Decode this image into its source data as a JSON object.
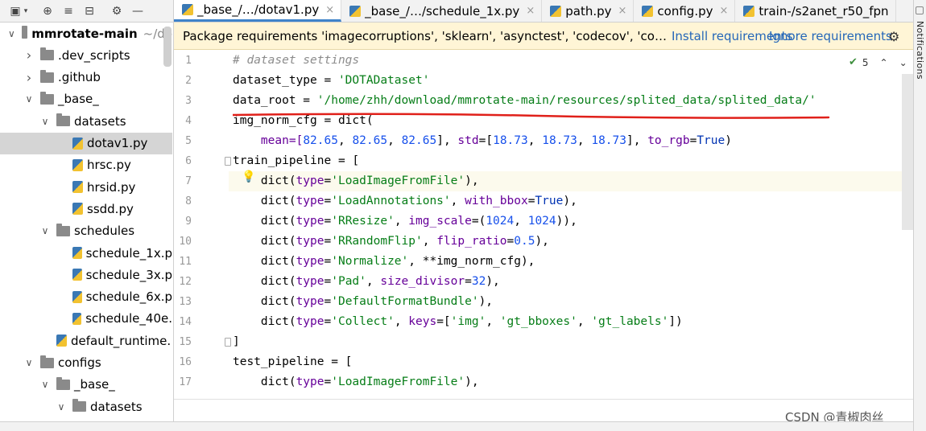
{
  "tabs": [
    {
      "label": "_base_/…/dotav1.py",
      "active": true,
      "closable": true,
      "icon": "python-file-icon"
    },
    {
      "label": "_base_/…/schedule_1x.py",
      "active": false,
      "closable": true,
      "icon": "python-file-icon"
    },
    {
      "label": "path.py",
      "active": false,
      "closable": true,
      "icon": "python-file-icon"
    },
    {
      "label": "config.py",
      "active": false,
      "closable": true,
      "icon": "python-file-icon"
    },
    {
      "label": "train-/s2anet_r50_fpn",
      "active": false,
      "closable": false,
      "icon": "python-file-icon"
    }
  ],
  "tab_close_glyph": "×",
  "project_tools": [
    "window-icon",
    "target-icon",
    "collapse-all-icon",
    "expand-all-icon",
    "gear-icon",
    "minimize-icon"
  ],
  "notifications_label": "Notifications",
  "tree": [
    {
      "label": "mmrotate-main",
      "suffix": "~/do",
      "kind": "root",
      "expanded": true,
      "bold": true
    },
    {
      "label": ".dev_scripts",
      "kind": "folder",
      "expanded": false
    },
    {
      "label": ".github",
      "kind": "folder",
      "expanded": false
    },
    {
      "label": "_base_",
      "kind": "folder",
      "expanded": true
    },
    {
      "label": "datasets",
      "kind": "folder",
      "expanded": true
    },
    {
      "label": "dotav1.py",
      "kind": "file",
      "selected": true
    },
    {
      "label": "hrsc.py",
      "kind": "file"
    },
    {
      "label": "hrsid.py",
      "kind": "file"
    },
    {
      "label": "ssdd.py",
      "kind": "file"
    },
    {
      "label": "schedules",
      "kind": "folder",
      "expanded": true
    },
    {
      "label": "schedule_1x.p",
      "kind": "file"
    },
    {
      "label": "schedule_3x.p",
      "kind": "file"
    },
    {
      "label": "schedule_6x.p",
      "kind": "file"
    },
    {
      "label": "schedule_40e.",
      "kind": "file"
    },
    {
      "label": "default_runtime.",
      "kind": "file"
    },
    {
      "label": "configs",
      "kind": "folder",
      "expanded": true
    },
    {
      "label": "_base_",
      "kind": "folder",
      "expanded": true
    },
    {
      "label": "datasets",
      "kind": "folder",
      "expanded": true
    }
  ],
  "banner": {
    "text": "Package requirements 'imagecorruptions', 'sklearn', 'asynctest', 'codecov', 'co…",
    "install_label": "Install requirements",
    "ignore_label": "Ignore requirements"
  },
  "inspections": {
    "count": "5"
  },
  "code_lines": [
    {
      "n": "1",
      "tokens": [
        {
          "t": "# dataset settings",
          "c": "com"
        }
      ]
    },
    {
      "n": "2",
      "tokens": [
        {
          "t": "dataset_type = ",
          "c": ""
        },
        {
          "t": "'DOTADataset'",
          "c": "str"
        }
      ]
    },
    {
      "n": "3",
      "tokens": [
        {
          "t": "data_root = ",
          "c": ""
        },
        {
          "t": "'/home/zhh/download/mmrotate-main/resources/splited_data/splited_data/'",
          "c": "str"
        }
      ]
    },
    {
      "n": "4",
      "tokens": [
        {
          "t": "img_norm_cfg = dict(",
          "c": ""
        }
      ]
    },
    {
      "n": "5",
      "tokens": [
        {
          "t": "    mean=[",
          "c": "key"
        },
        {
          "t": "82.65",
          "c": "num"
        },
        {
          "t": ", ",
          "c": ""
        },
        {
          "t": "82.65",
          "c": "num"
        },
        {
          "t": ", ",
          "c": ""
        },
        {
          "t": "82.65",
          "c": "num"
        },
        {
          "t": "], ",
          "c": ""
        },
        {
          "t": "std",
          "c": "key"
        },
        {
          "t": "=[",
          "c": ""
        },
        {
          "t": "18.73",
          "c": "num"
        },
        {
          "t": ", ",
          "c": ""
        },
        {
          "t": "18.73",
          "c": "num"
        },
        {
          "t": ", ",
          "c": ""
        },
        {
          "t": "18.73",
          "c": "num"
        },
        {
          "t": "], ",
          "c": ""
        },
        {
          "t": "to_rgb",
          "c": "key"
        },
        {
          "t": "=",
          "c": ""
        },
        {
          "t": "True",
          "c": "kw"
        },
        {
          "t": ")",
          "c": ""
        }
      ]
    },
    {
      "n": "6",
      "tokens": [
        {
          "t": "train_pipeline = [",
          "c": ""
        }
      ]
    },
    {
      "n": "7",
      "tokens": [
        {
          "t": "    dict(",
          "c": ""
        },
        {
          "t": "type",
          "c": "key"
        },
        {
          "t": "=",
          "c": ""
        },
        {
          "t": "'LoadImageFromFile'",
          "c": "str"
        },
        {
          "t": "),",
          "c": ""
        }
      ]
    },
    {
      "n": "8",
      "tokens": [
        {
          "t": "    dict(",
          "c": ""
        },
        {
          "t": "type",
          "c": "key"
        },
        {
          "t": "=",
          "c": ""
        },
        {
          "t": "'LoadAnnotations'",
          "c": "str"
        },
        {
          "t": ", ",
          "c": ""
        },
        {
          "t": "with_bbox",
          "c": "key"
        },
        {
          "t": "=",
          "c": ""
        },
        {
          "t": "True",
          "c": "kw"
        },
        {
          "t": "),",
          "c": ""
        }
      ]
    },
    {
      "n": "9",
      "tokens": [
        {
          "t": "    dict(",
          "c": ""
        },
        {
          "t": "type",
          "c": "key"
        },
        {
          "t": "=",
          "c": ""
        },
        {
          "t": "'RResize'",
          "c": "str"
        },
        {
          "t": ", ",
          "c": ""
        },
        {
          "t": "img_scale",
          "c": "key"
        },
        {
          "t": "=(",
          "c": ""
        },
        {
          "t": "1024",
          "c": "num"
        },
        {
          "t": ", ",
          "c": ""
        },
        {
          "t": "1024",
          "c": "num"
        },
        {
          "t": ")),",
          "c": ""
        }
      ]
    },
    {
      "n": "10",
      "tokens": [
        {
          "t": "    dict(",
          "c": ""
        },
        {
          "t": "type",
          "c": "key"
        },
        {
          "t": "=",
          "c": ""
        },
        {
          "t": "'RRandomFlip'",
          "c": "str"
        },
        {
          "t": ", ",
          "c": ""
        },
        {
          "t": "flip_ratio",
          "c": "key"
        },
        {
          "t": "=",
          "c": ""
        },
        {
          "t": "0.5",
          "c": "num"
        },
        {
          "t": "),",
          "c": ""
        }
      ]
    },
    {
      "n": "11",
      "tokens": [
        {
          "t": "    dict(",
          "c": ""
        },
        {
          "t": "type",
          "c": "key"
        },
        {
          "t": "=",
          "c": ""
        },
        {
          "t": "'Normalize'",
          "c": "str"
        },
        {
          "t": ", **img_norm_cfg),",
          "c": ""
        }
      ]
    },
    {
      "n": "12",
      "tokens": [
        {
          "t": "    dict(",
          "c": ""
        },
        {
          "t": "type",
          "c": "key"
        },
        {
          "t": "=",
          "c": ""
        },
        {
          "t": "'Pad'",
          "c": "str"
        },
        {
          "t": ", ",
          "c": ""
        },
        {
          "t": "size_divisor",
          "c": "key"
        },
        {
          "t": "=",
          "c": ""
        },
        {
          "t": "32",
          "c": "num"
        },
        {
          "t": "),",
          "c": ""
        }
      ]
    },
    {
      "n": "13",
      "tokens": [
        {
          "t": "    dict(",
          "c": ""
        },
        {
          "t": "type",
          "c": "key"
        },
        {
          "t": "=",
          "c": ""
        },
        {
          "t": "'DefaultFormatBundle'",
          "c": "str"
        },
        {
          "t": "),",
          "c": ""
        }
      ]
    },
    {
      "n": "14",
      "tokens": [
        {
          "t": "    dict(",
          "c": ""
        },
        {
          "t": "type",
          "c": "key"
        },
        {
          "t": "=",
          "c": ""
        },
        {
          "t": "'Collect'",
          "c": "str"
        },
        {
          "t": ", ",
          "c": ""
        },
        {
          "t": "keys",
          "c": "key"
        },
        {
          "t": "=[",
          "c": ""
        },
        {
          "t": "'img'",
          "c": "str"
        },
        {
          "t": ", ",
          "c": ""
        },
        {
          "t": "'gt_bboxes'",
          "c": "str"
        },
        {
          "t": ", ",
          "c": ""
        },
        {
          "t": "'gt_labels'",
          "c": "str"
        },
        {
          "t": "])",
          "c": ""
        }
      ]
    },
    {
      "n": "15",
      "tokens": [
        {
          "t": "]",
          "c": ""
        }
      ]
    },
    {
      "n": "16",
      "tokens": [
        {
          "t": "test_pipeline = [",
          "c": ""
        }
      ]
    },
    {
      "n": "17",
      "tokens": [
        {
          "t": "    dict(",
          "c": ""
        },
        {
          "t": "type",
          "c": "key"
        },
        {
          "t": "=",
          "c": ""
        },
        {
          "t": "'LoadImageFromFile'",
          "c": "str"
        },
        {
          "t": "),",
          "c": ""
        }
      ]
    }
  ],
  "highlighted_line": "7",
  "watermark": "CSDN @青椒肉丝_",
  "colors": {
    "accent": "#4083c9",
    "annotation": "#e0201a",
    "banner_bg": "#fff5d6",
    "link": "#2466b8"
  }
}
